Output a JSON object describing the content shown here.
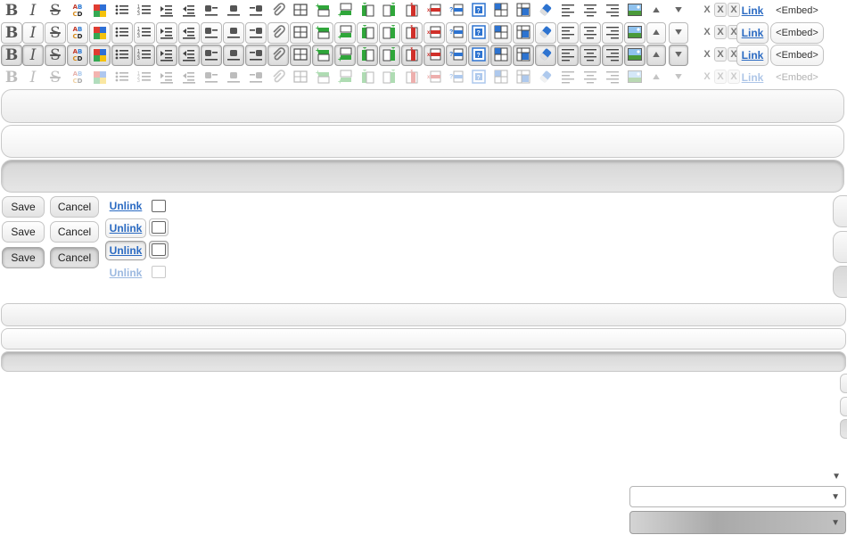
{
  "toolbar": {
    "states": [
      "normal",
      "hover",
      "active",
      "disabled"
    ],
    "buttons": {
      "bold": "B",
      "italic": "I",
      "strike": "S",
      "spell": [
        "A",
        "B",
        "C",
        "D"
      ],
      "link": "Link",
      "embed": "<Embed>"
    },
    "remove_marks": [
      "X",
      "X",
      "X"
    ]
  },
  "controls": {
    "save_label": "Save",
    "cancel_label": "Cancel",
    "unlink_label": "Unlink"
  },
  "colors": {
    "link": "#2a6ac2",
    "insert_green": "#2fa63a",
    "delete_red": "#d0302a",
    "table_blue": "#2d73d0"
  },
  "icons": [
    "bold-icon",
    "italic-icon",
    "strikethrough-icon",
    "spellcheck-icon",
    "color-icon",
    "bullet-list-icon",
    "numbered-list-icon",
    "indent-icon",
    "outdent-icon",
    "align-left-block-icon",
    "align-center-block-icon",
    "align-right-block-icon",
    "attachment-icon",
    "table-icon",
    "insert-row-above-icon",
    "insert-row-below-icon",
    "insert-column-left-icon",
    "insert-column-right-icon",
    "delete-column-icon",
    "delete-row-icon",
    "help-icon",
    "table-props-icon",
    "cell-props-icon",
    "merge-cells-icon",
    "eraser-icon",
    "align-left-icon",
    "align-center-icon",
    "align-right-icon",
    "image-icon",
    "arrow-up-icon",
    "arrow-down-icon"
  ]
}
